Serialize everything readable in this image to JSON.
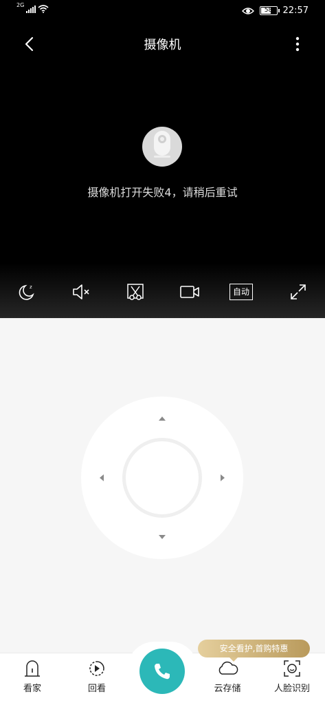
{
  "status_bar": {
    "network": "2G",
    "battery": "58",
    "time": "22:57"
  },
  "header": {
    "title": "摄像机"
  },
  "video": {
    "error_message": "摄像机打开失败4，请稍后重试"
  },
  "toolbar": {
    "auto_label": "自动"
  },
  "icons": {
    "back": "chevron-left-icon",
    "more": "more-vertical-icon",
    "camera": "camera-icon",
    "sleep": "moon-sleep-icon",
    "mute": "speaker-mute-icon",
    "screenshot": "scissors-icon",
    "record": "video-record-icon",
    "fullscreen": "expand-icon",
    "call": "phone-icon"
  },
  "promo": {
    "text": "安全看护,首购特惠"
  },
  "bottom_nav": {
    "items": [
      {
        "label": "看家",
        "icon": "house-guard-icon"
      },
      {
        "label": "回看",
        "icon": "playback-icon"
      },
      {
        "label": "云存储",
        "icon": "cloud-icon"
      },
      {
        "label": "人脸识别",
        "icon": "face-scan-icon"
      }
    ]
  },
  "colors": {
    "accent": "#2cb8b8",
    "promo_gold": "#c9ad74",
    "video_bg": "#000000"
  }
}
